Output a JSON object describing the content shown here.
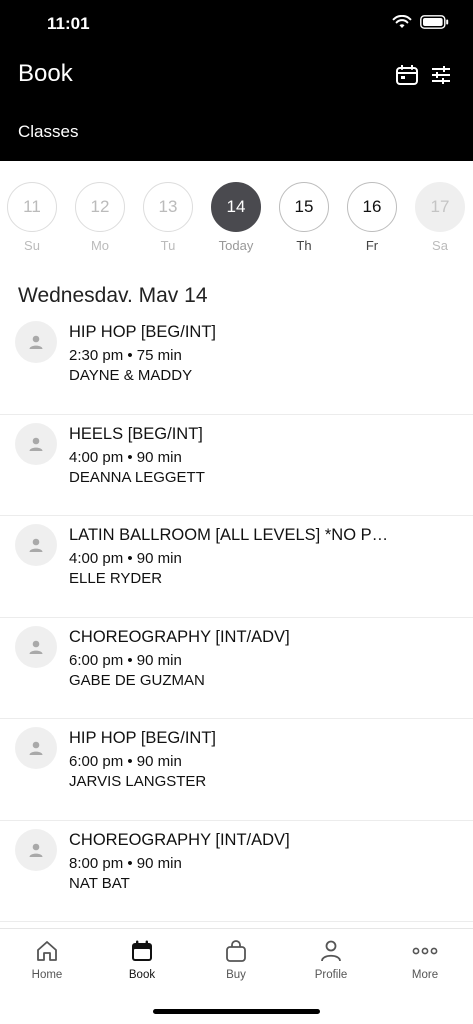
{
  "status": {
    "time": "11:01"
  },
  "header": {
    "title": "Book",
    "subtitle": "Classes"
  },
  "dates": [
    {
      "num": "11",
      "day": "Su",
      "state": "disabled-light"
    },
    {
      "num": "12",
      "day": "Mo",
      "state": "disabled-light"
    },
    {
      "num": "13",
      "day": "Tu",
      "state": "disabled-light"
    },
    {
      "num": "14",
      "day": "Today",
      "state": "selected"
    },
    {
      "num": "15",
      "day": "Th",
      "state": "active"
    },
    {
      "num": "16",
      "day": "Fr",
      "state": "active"
    },
    {
      "num": "17",
      "day": "Sa",
      "state": "disabled"
    }
  ],
  "date_heading": "Wednesdav. Mav 14",
  "classes": [
    {
      "title": "HIP HOP [BEG/INT]",
      "time": "2:30 pm • 75 min",
      "teacher": "DAYNE & MADDY"
    },
    {
      "title": "HEELS [BEG/INT]",
      "time": "4:00 pm • 90 min",
      "teacher": "DEANNA LEGGETT"
    },
    {
      "title": "LATIN BALLROOM [ALL LEVELS] *NO P…",
      "time": "4:00 pm • 90 min",
      "teacher": "ELLE RYDER"
    },
    {
      "title": "CHOREOGRAPHY [INT/ADV]",
      "time": "6:00 pm • 90 min",
      "teacher": "GABE DE GUZMAN"
    },
    {
      "title": "HIP HOP [BEG/INT]",
      "time": "6:00 pm • 90 min",
      "teacher": "JARVIS LANGSTER"
    },
    {
      "title": "CHOREOGRAPHY [INT/ADV]",
      "time": "8:00 pm • 90 min",
      "teacher": "NAT BAT"
    }
  ],
  "tabs": [
    {
      "label": "Home",
      "icon": "home-icon"
    },
    {
      "label": "Book",
      "icon": "calendar-icon",
      "active": true
    },
    {
      "label": "Buy",
      "icon": "shopping-bag-icon"
    },
    {
      "label": "Profile",
      "icon": "person-icon"
    },
    {
      "label": "More",
      "icon": "more-icon"
    }
  ]
}
